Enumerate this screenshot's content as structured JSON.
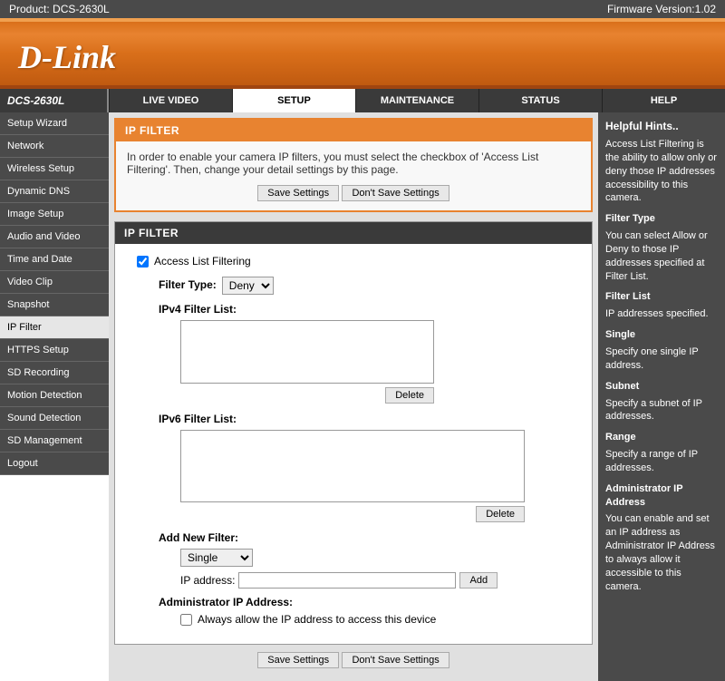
{
  "top": {
    "product_label": "Product: DCS-2630L",
    "firmware_label": "Firmware Version:1.02"
  },
  "banner": {
    "logo_text": "D-Link"
  },
  "model": "DCS-2630L",
  "tabs": [
    {
      "label": "LIVE VIDEO",
      "active": false
    },
    {
      "label": "SETUP",
      "active": true
    },
    {
      "label": "MAINTENANCE",
      "active": false
    },
    {
      "label": "STATUS",
      "active": false
    },
    {
      "label": "HELP",
      "active": false
    }
  ],
  "sidebar": [
    "Setup Wizard",
    "Network",
    "Wireless Setup",
    "Dynamic DNS",
    "Image Setup",
    "Audio and Video",
    "Time and Date",
    "Video Clip",
    "Snapshot",
    "IP Filter",
    "HTTPS Setup",
    "SD Recording",
    "Motion Detection",
    "Sound Detection",
    "SD Management",
    "Logout"
  ],
  "sidebar_active": 9,
  "panel": {
    "header": "IP FILTER",
    "intro": "In order to enable your camera IP filters, you must select the checkbox of 'Access List Filtering'. Then, change your detail settings by this page.",
    "save": "Save Settings",
    "dont_save": "Don't Save Settings",
    "section_header": "IP FILTER",
    "access_list_label": "Access List Filtering",
    "filter_type_label": "Filter Type:",
    "filter_type_value": "Deny",
    "ipv4_label": "IPv4 Filter List:",
    "ipv6_label": "IPv6 Filter List:",
    "delete": "Delete",
    "add_new_label": "Add New Filter:",
    "add_new_type": "Single",
    "ip_addr_label": "IP address:",
    "ip_addr_value": "",
    "add": "Add",
    "admin_ip_label": "Administrator IP Address:",
    "admin_allow_label": "Always allow the IP address to access this device"
  },
  "help": {
    "title": "Helpful Hints..",
    "hints": [
      {
        "head": "",
        "text": "Access List Filtering is the ability to allow only or deny those IP addresses accessibility to this camera."
      },
      {
        "head": "Filter Type",
        "text": "You can select Allow or Deny to those IP addresses specified at Filter List."
      },
      {
        "head": "Filter List",
        "text": "IP addresses specified."
      },
      {
        "head": "Single",
        "text": "Specify one single IP address."
      },
      {
        "head": "Subnet",
        "text": "Specify a subnet of IP addresses."
      },
      {
        "head": "Range",
        "text": "Specify a range of IP addresses."
      },
      {
        "head": "Administrator IP Address",
        "text": "You can enable and set an IP address as Administrator IP Address to always allow it accessible to this camera."
      }
    ]
  }
}
